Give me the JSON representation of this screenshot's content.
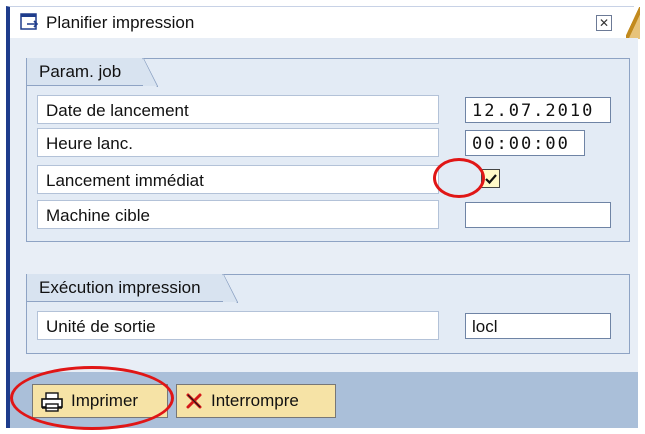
{
  "window": {
    "title": "Planifier impression"
  },
  "group_job": {
    "title": "Param. job",
    "start_date": {
      "label": "Date de lancement",
      "value": "12.07.2010"
    },
    "start_time": {
      "label": "Heure lanc.",
      "value": "00:00:00"
    },
    "immediate": {
      "label": "Lancement immédiat",
      "checked": true
    },
    "target_machine": {
      "label": "Machine cible",
      "value": ""
    }
  },
  "group_print": {
    "title": "Exécution impression",
    "output_device": {
      "label": "Unité de sortie",
      "value": "locl"
    }
  },
  "toolbar": {
    "print_label": "Imprimer",
    "cancel_label": "Interrompre"
  },
  "icons": {
    "window": "dialog-icon",
    "close": "close-icon",
    "print": "printer-icon",
    "cancel": "cancel-x-icon"
  },
  "colors": {
    "annotation": "#e01616",
    "button": "#f6e3a6",
    "frame_accent": "#1e3c8c"
  }
}
